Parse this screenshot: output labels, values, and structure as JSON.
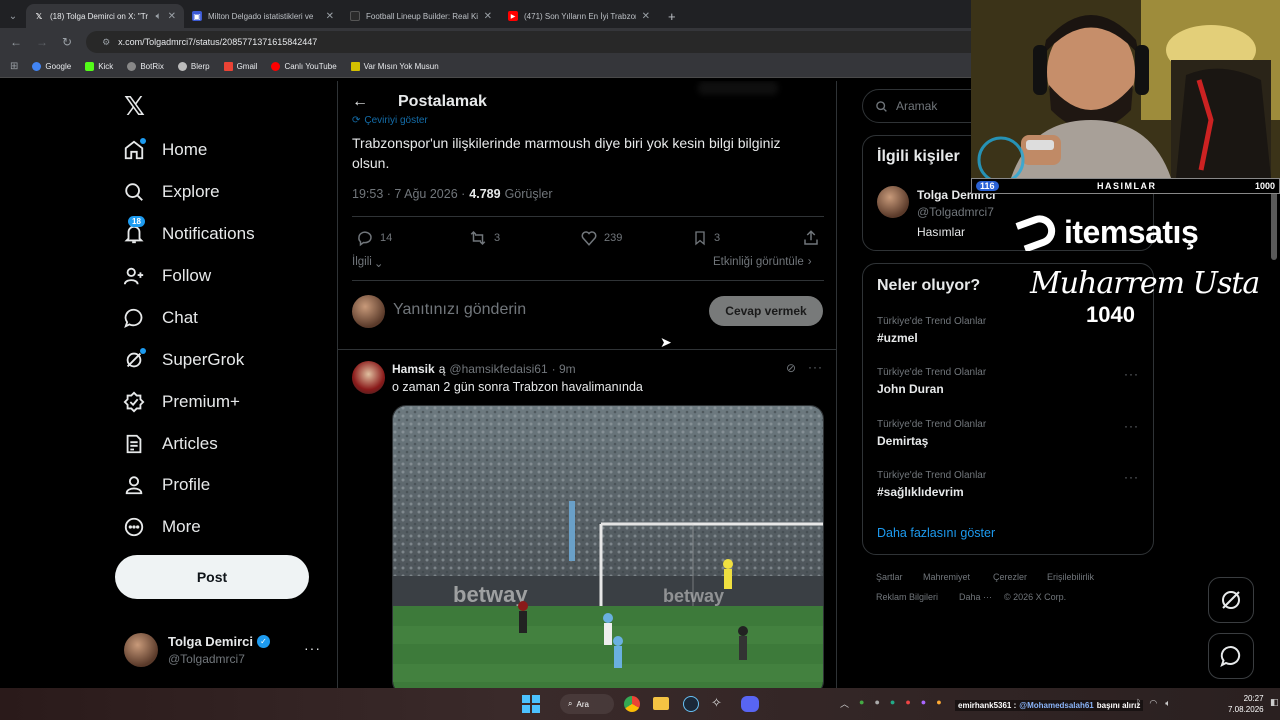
{
  "browser": {
    "tabs": [
      {
        "title": "(18) Tolga Demirci on X: \"Tr",
        "icon": "x-logo",
        "active": true
      },
      {
        "title": "Milton Delgado istatistikleri ve",
        "icon": "stats-icon",
        "active": false
      },
      {
        "title": "Football Lineup Builder: Real Ki",
        "icon": "lineup-icon",
        "active": false
      },
      {
        "title": "(471) Son Yılların En İyi Trabzon",
        "icon": "youtube-icon",
        "active": false
      }
    ],
    "url": "x.com/Tolgadmrci7/status/2085771371615842447",
    "bookmarks": [
      {
        "label": "Google",
        "color": "#4285f4"
      },
      {
        "label": "Kick",
        "color": "#53fc18"
      },
      {
        "label": "BotRix",
        "color": "#e8eaed"
      },
      {
        "label": "Blerp",
        "color": "#e8eaed"
      },
      {
        "label": "Gmail",
        "color": "#ea4335"
      },
      {
        "label": "Canlı YouTube",
        "color": "#ff0000"
      },
      {
        "label": "Var Mısın Yok Musun",
        "color": "#d4c100"
      }
    ]
  },
  "nav": {
    "items": [
      {
        "label": "Home",
        "icon": "home-icon"
      },
      {
        "label": "Explore",
        "icon": "search-icon"
      },
      {
        "label": "Notifications",
        "icon": "bell-icon",
        "badge": "18"
      },
      {
        "label": "Follow",
        "icon": "follow-icon"
      },
      {
        "label": "Chat",
        "icon": "chat-icon"
      },
      {
        "label": "SuperGrok",
        "icon": "grok-icon"
      },
      {
        "label": "Premium+",
        "icon": "premium-icon"
      },
      {
        "label": "Articles",
        "icon": "articles-icon"
      },
      {
        "label": "Profile",
        "icon": "profile-icon"
      },
      {
        "label": "More",
        "icon": "more-icon"
      }
    ],
    "post_label": "Post",
    "account": {
      "name": "Tolga Demirci",
      "handle": "@Tolgadmrci7"
    }
  },
  "header": {
    "title": "Postalamak"
  },
  "tweet": {
    "translate_label": "Çeviriyi göster",
    "text": "Trabzonspor'un ilişkilerinde marmoush diye biri yok kesin bilgi bilginiz olsun.",
    "time": "19:53 · 7 Ağu 2026 ·",
    "views": "4.789",
    "views_label": "Görüşler",
    "replies": "14",
    "retweets": "3",
    "likes": "239",
    "bookmarks": "3",
    "relevant_label": "İlgili",
    "activity_label": "Etkinliği görüntüle"
  },
  "reply_box": {
    "placeholder": "Yanıtınızı gönderin",
    "button": "Cevap vermek"
  },
  "reply": {
    "name": "Hamsik",
    "flag": "ą",
    "handle": "@hamsikfedaisi61",
    "time": "· 9m",
    "text": "o zaman 2 gün sonra Trabzon havalimanında"
  },
  "search": {
    "placeholder": "Aramak"
  },
  "related": {
    "title": "İlgili kişiler",
    "name": "Tolga Demirci",
    "handle": "@Tolgadmrci7",
    "bio": "Hasımlar"
  },
  "trends": {
    "title": "Neler oluyor?",
    "items": [
      {
        "category": "Türkiye'de Trend Olanlar",
        "name": "#uzmel"
      },
      {
        "category": "Türkiye'de Trend Olanlar",
        "name": "John Duran"
      },
      {
        "category": "Türkiye'de Trend Olanlar",
        "name": "Demirtaş"
      },
      {
        "category": "Türkiye'de Trend Olanlar",
        "name": "#sağlıklıdevrim"
      }
    ],
    "show_more": "Daha fazlasını göster"
  },
  "footer": {
    "links": [
      "Şartlar",
      "Mahremiyet",
      "Çerezler",
      "Erişilebilirlik",
      "Reklam Bilgileri",
      "Daha ···",
      "© 2026 X Corp."
    ]
  },
  "overlay": {
    "bar_left": "116",
    "bar_title": "HASIMLAR",
    "bar_right": "1000",
    "sponsor": "itemsatış",
    "signature": "Muharrem Usta",
    "number": "1040"
  },
  "taskbar": {
    "search_label": "Ara",
    "chat_user": "emirhank5361 :",
    "chat_mention": "@Mohamedsalah61",
    "chat_text": "başını alırız",
    "time": "20:27",
    "date": "7.08.2026"
  },
  "colors": {
    "accent": "#1d9bf0",
    "background": "#000000",
    "border": "#2f3336",
    "muted": "#71767b"
  }
}
